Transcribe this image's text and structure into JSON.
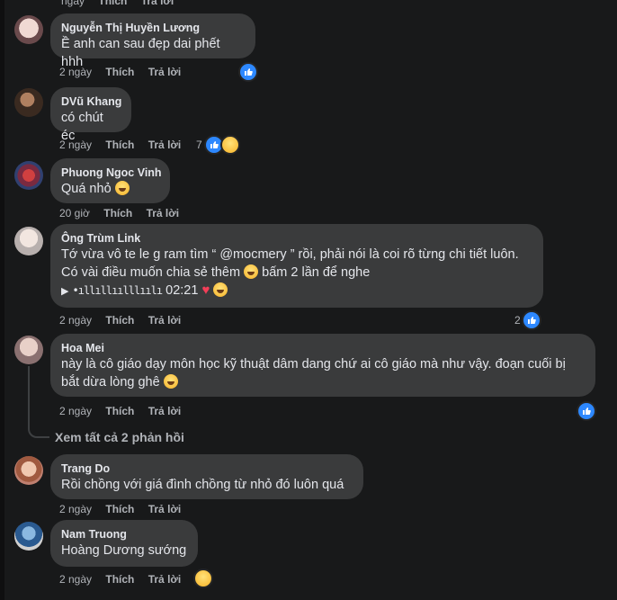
{
  "top_cut": {
    "time": "ngày",
    "like": "Thích",
    "reply": "Trả lời"
  },
  "comments": [
    {
      "author": "Nguyễn Thị Huyền Lương",
      "lines": [
        "Ề anh can sau đẹp dai phết hhh"
      ],
      "time": "2 ngày",
      "like": "Thích",
      "reply": "Trả lời",
      "reaction_count": ""
    },
    {
      "author": "DVũ Khang",
      "lines": [
        "có chút éc"
      ],
      "time": "2 ngày",
      "like": "Thích",
      "reply": "Trả lời",
      "reaction_count": "7"
    },
    {
      "author": "Phuong Ngoc Vinh",
      "lines": [
        "Quá nhỏ"
      ],
      "time": "20 giờ",
      "like": "Thích",
      "reply": "Trả lời",
      "reaction_count": ""
    },
    {
      "author": "Ông Trùm Link",
      "lines": [
        "Tớ vừa vô te le g ram tìm “ @mocmery ” rồi, phải nói là coi rõ từng chi tiết luôn.",
        "Có vài điều muốn chia sẻ thêm",
        "bấm 2 lần để nghe"
      ],
      "audio_time": "02:21",
      "time": "2 ngày",
      "like": "Thích",
      "reply": "Trả lời",
      "reaction_count": "2"
    },
    {
      "author": "Hoa Mei",
      "lines": [
        "này là cô giáo dạy môn học kỹ thuật dâm dang chứ ai cô giáo mà như vậy. đoạn cuối bị",
        "bắt dừa lòng ghê"
      ],
      "time": "2 ngày",
      "like": "Thích",
      "reply": "Trả lời",
      "reaction_count": ""
    },
    {
      "author": "Trang Do",
      "lines": [
        "Rồi chồng với giá đình chồng từ nhỏ đó luôn quá"
      ],
      "time": "2 ngày",
      "like": "Thích",
      "reply": "Trả lời",
      "reaction_count": ""
    },
    {
      "author": "Nam Truong",
      "lines": [
        "Hoàng Dương sướng"
      ],
      "time": "2 ngày",
      "like": "Thích",
      "reply": "Trả lời",
      "reaction_count": ""
    }
  ],
  "view_replies": "Xem tất cả 2 phản hồi",
  "colors": {
    "background": "#18191a",
    "bubble": "#3a3b3c",
    "text": "#e4e6eb",
    "muted": "#b0b3b8",
    "like_blue": "#2d88ff",
    "heart": "#f33e58"
  },
  "icons": [
    "like-icon",
    "haha-icon",
    "heart-icon",
    "play-icon",
    "grinning-emoji-icon",
    "sad-emoji-icon"
  ]
}
